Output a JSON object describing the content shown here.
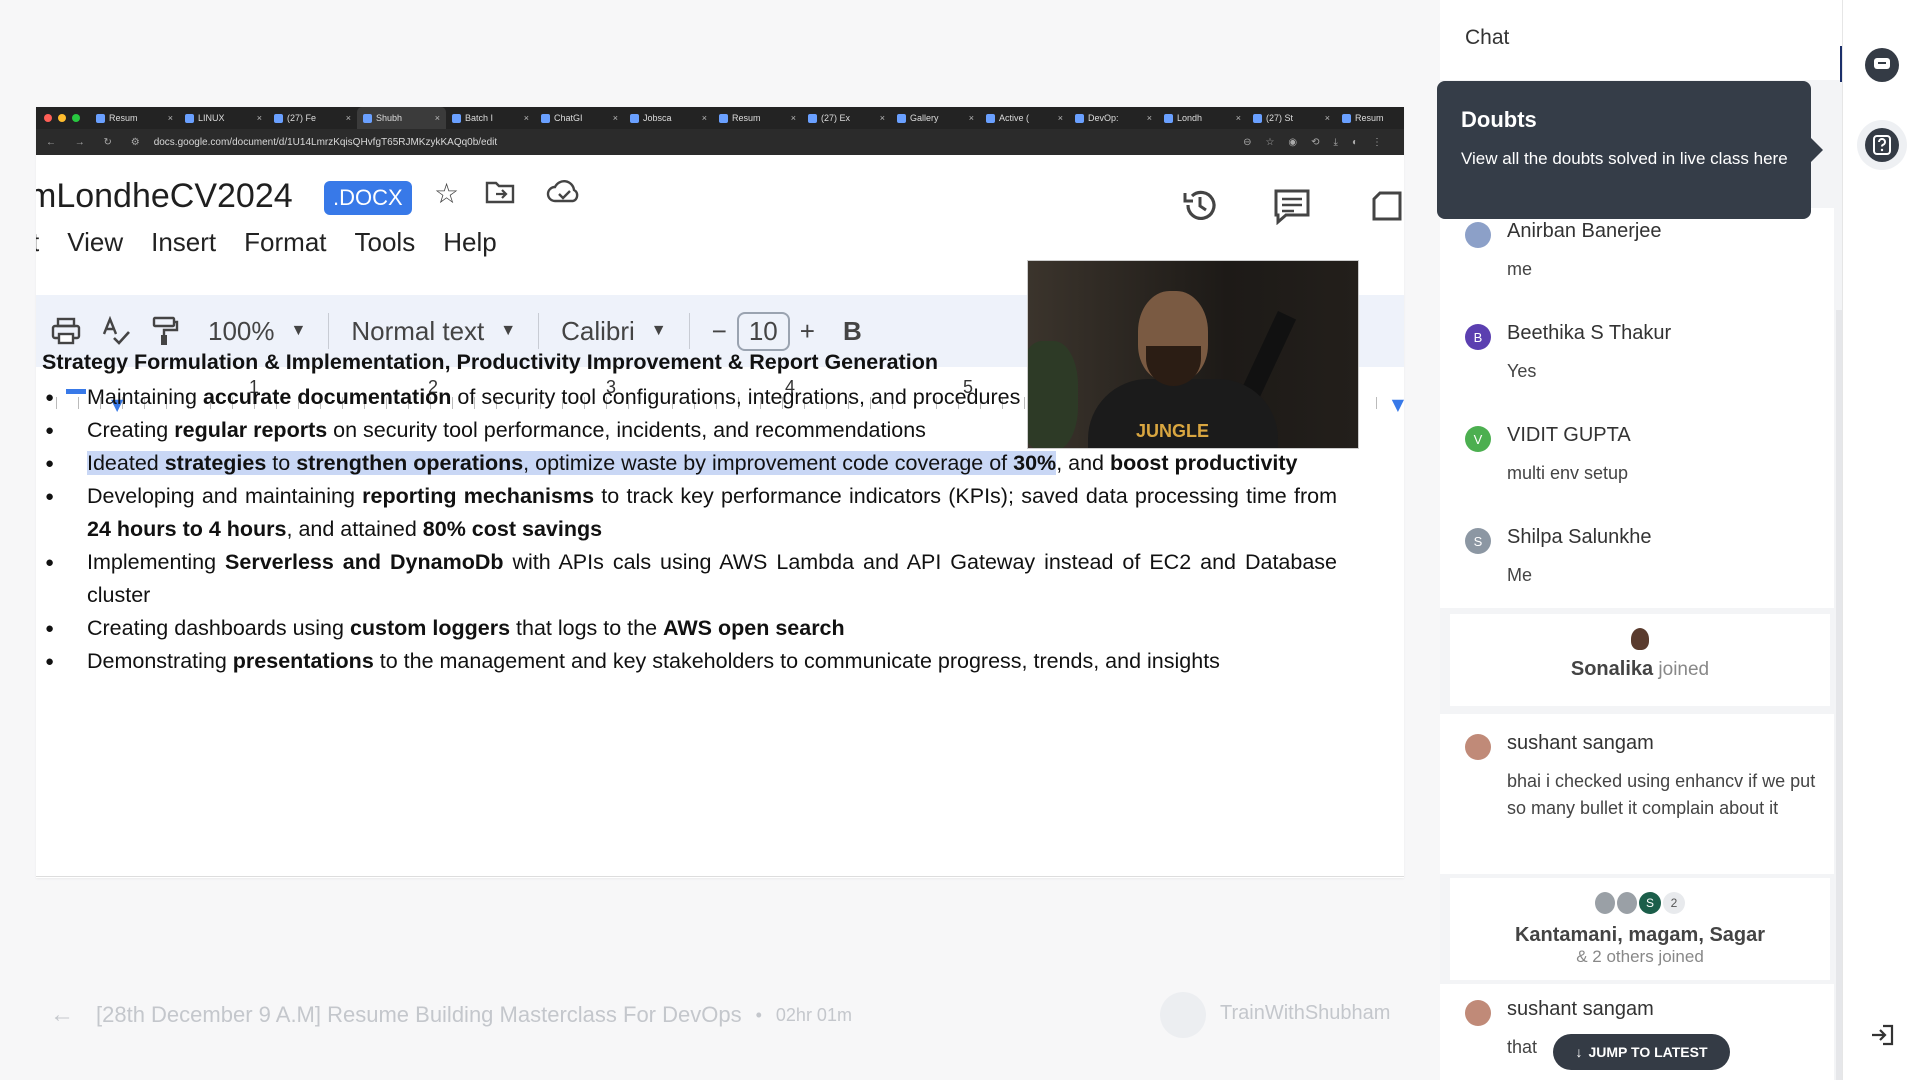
{
  "browser": {
    "tabs": [
      "Resum",
      "LINUX",
      "(27) Fe",
      "Shubh",
      "Batch I",
      "ChatGI",
      "Jobsca",
      "Resum",
      "(27) Ex",
      "Gallery",
      "Active (",
      "DevOp:",
      "Londh",
      "(27) St",
      "Resum"
    ],
    "url": "docs.google.com/document/d/1U14LmrzKqisQHvfgT65RJMKzykKAQq0b/edit"
  },
  "doc": {
    "title": "mLondheCV2024",
    "badge": ".DOCX",
    "menu": [
      "t",
      "View",
      "Insert",
      "Format",
      "Tools",
      "Help"
    ],
    "toolbar": {
      "zoom": "100%",
      "style": "Normal text",
      "font": "Calibri",
      "size": "10",
      "minus": "−",
      "plus": "+",
      "bold": "B"
    },
    "ruler": [
      "1",
      "2",
      "3",
      "4",
      "5"
    ],
    "heading": "Strategy Formulation & Implementation, Productivity Improvement & Report Generation",
    "bullets": [
      [
        [
          "Maintaining ",
          false
        ],
        [
          "accurate documentation",
          true
        ],
        [
          " of security tool configurations, integrations, and procedures",
          false
        ]
      ],
      [
        [
          "Creating ",
          false
        ],
        [
          "regular reports",
          true
        ],
        [
          " on security tool performance, incidents, and recommendations",
          false
        ]
      ],
      [
        [
          "HL:Ideated ",
          false
        ],
        [
          "HL:strategies",
          true
        ],
        [
          "HL: to ",
          false
        ],
        [
          "HL:strengthen operations",
          true
        ],
        [
          "HL:, optimize waste by improvement code coverage of ",
          false
        ],
        [
          "HL:30%",
          true
        ],
        [
          ", and ",
          false
        ],
        [
          "boost productivity",
          true
        ]
      ],
      [
        [
          "Developing and maintaining ",
          false
        ],
        [
          "reporting mechanisms",
          true
        ],
        [
          " to track key performance indicators (KPIs); saved data processing time from ",
          false
        ],
        [
          "24 hours to 4 hours",
          true
        ],
        [
          ", and attained ",
          false
        ],
        [
          "80% cost savings",
          true
        ]
      ],
      [
        [
          "Implementing ",
          false
        ],
        [
          "Serverless and DynamoDb",
          true
        ],
        [
          " with APIs cals using AWS Lambda and API Gateway instead of EC2 and Database cluster",
          false
        ]
      ],
      [
        [
          "Creating dashboards using ",
          false
        ],
        [
          "custom loggers",
          true
        ],
        [
          " that logs to the ",
          false
        ],
        [
          "AWS open search",
          true
        ]
      ],
      [
        [
          "Demonstrating ",
          false
        ],
        [
          "presentations",
          true
        ],
        [
          " to the management and key stakeholders to communicate progress, trends, and insights",
          false
        ]
      ]
    ]
  },
  "webcam": {
    "brand": "JUNGLE"
  },
  "footer": {
    "session_title": "[28th December 9 A.M] Resume Building Masterclass For DevOps",
    "separator": "•",
    "duration": "02hr 01m",
    "host": "TrainWithShubham"
  },
  "chat": {
    "header": "Chat",
    "tooltip_title": "Doubts",
    "tooltip_text": "View all the doubts solved in live class here",
    "messages": [
      {
        "name": "Anirban Banerjee",
        "text": "me",
        "initial": "",
        "color": "#8ca0c8"
      },
      {
        "name": "Beethika S Thakur",
        "text": "Yes",
        "initial": "B",
        "color": "#5b3fb0"
      },
      {
        "name": "VIDIT GUPTA",
        "text": "multi env setup",
        "initial": "V",
        "color": "#4caf50"
      },
      {
        "name": "Shilpa Salunkhe",
        "text": "Me",
        "initial": "S",
        "color": "#8c97a3"
      }
    ],
    "joined_single": {
      "name": "Sonalika",
      "suffix": " joined"
    },
    "msg2": {
      "name": "sushant sangam",
      "text": "bhai i checked using enhancv if we put so many bullet it complain about it"
    },
    "joined_group": {
      "names": "Kantamani, magam, Sagar",
      "suffix": "& 2 others joined",
      "count": "2",
      "avatar_initial": "S"
    },
    "msg3": {
      "name": "sushant sangam",
      "text": "that"
    },
    "jump_label": "JUMP TO LATEST"
  }
}
